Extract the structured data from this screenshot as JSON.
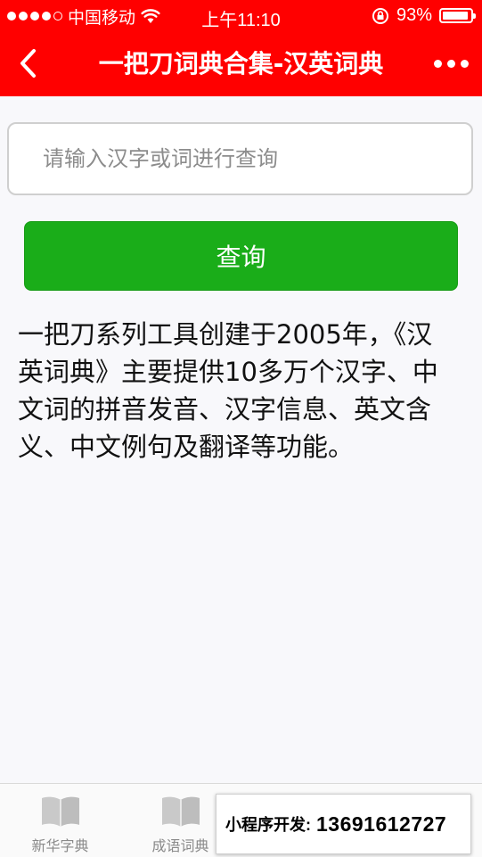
{
  "status_bar": {
    "carrier": "中国移动",
    "time": "上午11:10",
    "battery_percent": "93%",
    "battery_level": 0.93,
    "signal_bars_filled": 4
  },
  "nav": {
    "title": "一把刀词典合集-汉英词典",
    "back_icon": "chevron-left-icon",
    "more_icon": "more-dots-icon"
  },
  "search": {
    "placeholder": "请输入汉字或词进行查询",
    "value": ""
  },
  "query_button_label": "查询",
  "intro": " 一把刀系列工具创建于2005年，《汉英词典》主要提供10多万个汉字、中文词的拼音发音、汉字信息、英文含义、中文例句及翻译等功能。",
  "tabs": [
    {
      "label": "新华字典",
      "icon": "book-icon"
    },
    {
      "label": "成语词典",
      "icon": "book-icon"
    }
  ],
  "contact": {
    "label": "小程序开发:",
    "phone": "13691612727"
  },
  "colors": {
    "header_bg": "#ff0000",
    "button_bg": "#1aad19",
    "page_bg": "#f8f8fb"
  }
}
